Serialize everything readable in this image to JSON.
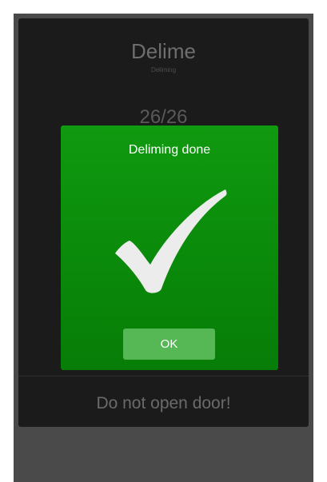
{
  "app": {
    "title": "Delime",
    "subtitle": "Deliming",
    "progress": "26/26",
    "warning": "Do not open door!"
  },
  "dialog": {
    "title": "Deliming done",
    "icon": "checkmark-icon",
    "ok_label": "OK",
    "accent_color": "#0a8f0a",
    "button_color": "#55b855"
  }
}
